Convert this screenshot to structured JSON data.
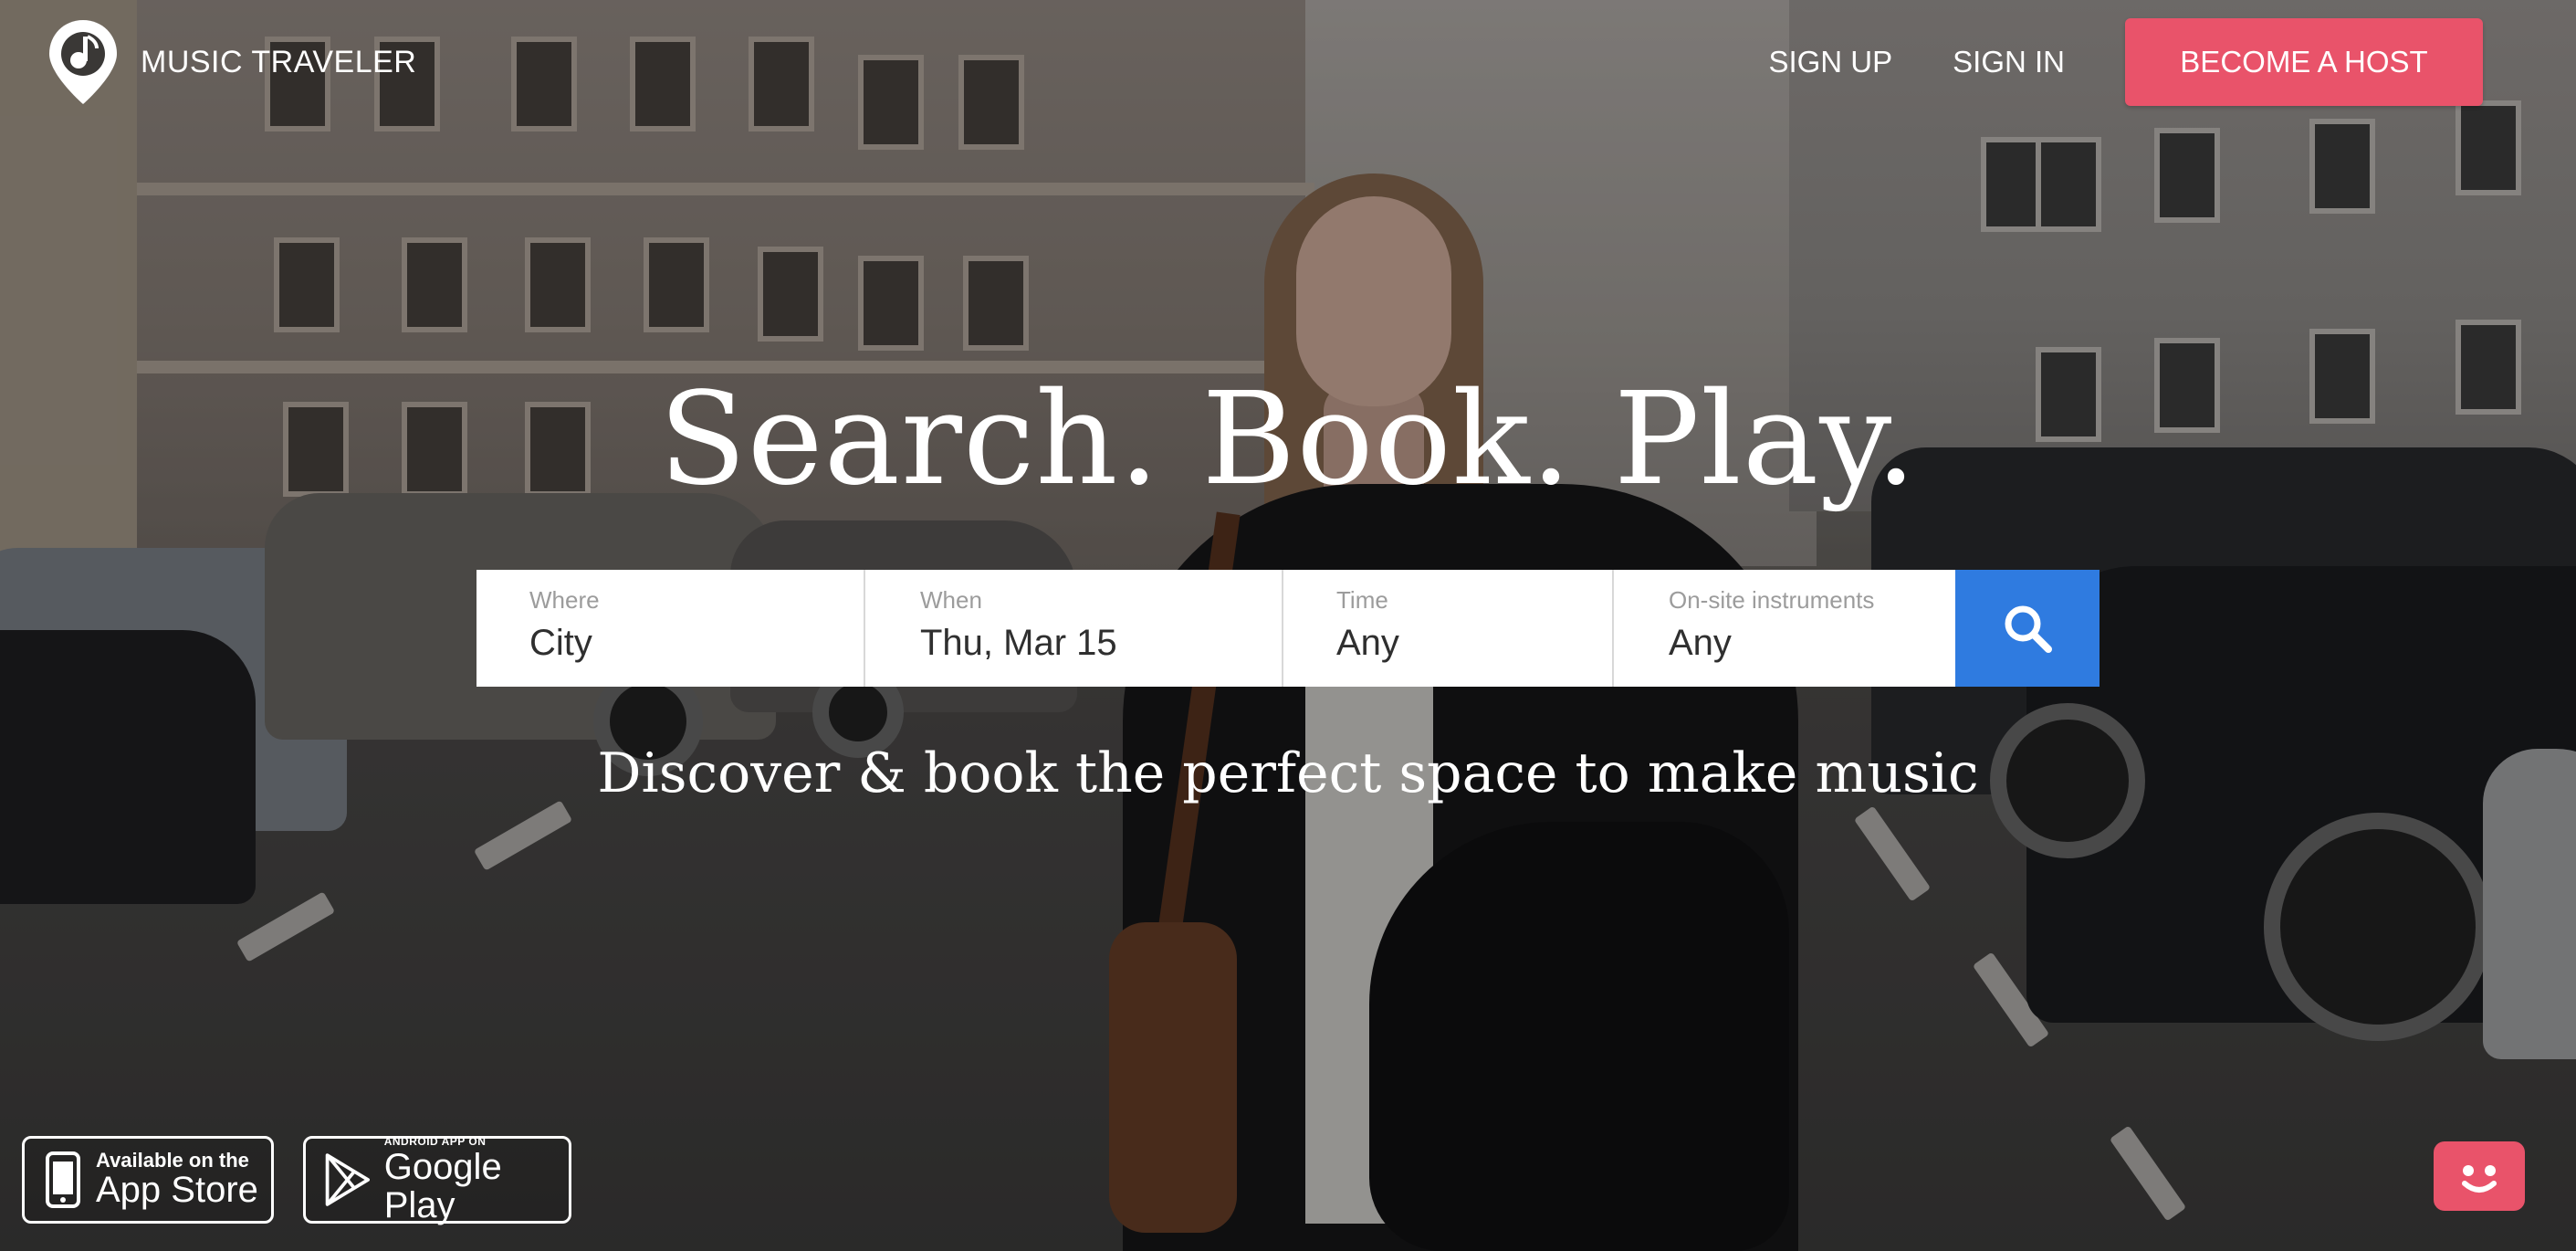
{
  "brand": {
    "name": "MUSIC TRAVELER"
  },
  "nav": {
    "sign_up": "SIGN UP",
    "sign_in": "SIGN IN",
    "become_host": "BECOME A HOST"
  },
  "hero": {
    "headline": "Search. Book. Play.",
    "tagline": "Discover & book the perfect space to make music"
  },
  "search": {
    "where": {
      "label": "Where",
      "value": "City"
    },
    "when": {
      "label": "When",
      "value": "Thu, Mar 15"
    },
    "time": {
      "label": "Time",
      "value": "Any"
    },
    "instruments": {
      "label": "On-site instruments",
      "value": "Any"
    },
    "button_icon": "search-icon"
  },
  "badges": {
    "app_store": {
      "small": "Available on the",
      "big": "App Store"
    },
    "google_play": {
      "small": "ANDROID APP ON",
      "big": "Google Play"
    }
  },
  "colors": {
    "accent": "#e9536a",
    "search_button": "#2f7be0",
    "text_light": "#ffffff",
    "field_label": "#9c9c9c"
  }
}
